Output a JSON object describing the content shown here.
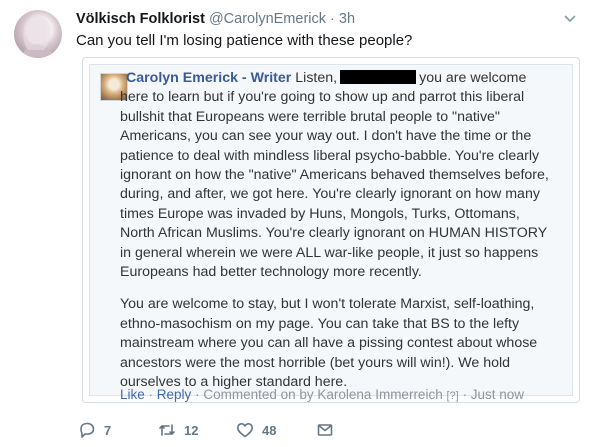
{
  "tweet": {
    "display_name": "Völkisch Folklorist",
    "handle": "@CarolynEmerick",
    "separator": "·",
    "time": "3h",
    "text": "Can you tell I'm losing patience with these people?"
  },
  "quote": {
    "author": "Carolyn Emerick - Writer",
    "lead": "Listen,",
    "paragraph1_rest": "you are welcome here to learn but if you're going to show up and parrot this liberal bullshit that Europeans were terrible brutal people to \"native\" Americans, you can see your way out. I don't have the time or the patience to deal with mindless liberal psycho-babble. You're clearly ignorant on how the \"native\" Americans behaved themselves before, during, and after, we got here. You're clearly ignorant on how many times Europe was invaded by Huns, Mongols, Turks, Ottomans, North African Muslims. You're clearly ignorant on HUMAN HISTORY in general wherein we were ALL war-like people, it just so happens Europeans had better technology more recently.",
    "paragraph2": "You are welcome to stay, but I won't tolerate Marxist, self-loathing, ethno-masochism on my page. You can take that BS to the lefty mainstream where you can all have a pissing contest about whose ancestors were the most horrible (bet yours will win!). We hold ourselves to a higher standard here.",
    "meta": {
      "like": "Like",
      "reply": "Reply",
      "commented_on": "Commented on by Karolena Immerreich",
      "help": "[?]",
      "time": "Just now",
      "sep": "·"
    }
  },
  "actions": {
    "replies": "7",
    "retweets": "12",
    "likes": "48"
  },
  "colors": {
    "link": "#4267b2",
    "author": "#3b5998",
    "muted": "#657786"
  }
}
